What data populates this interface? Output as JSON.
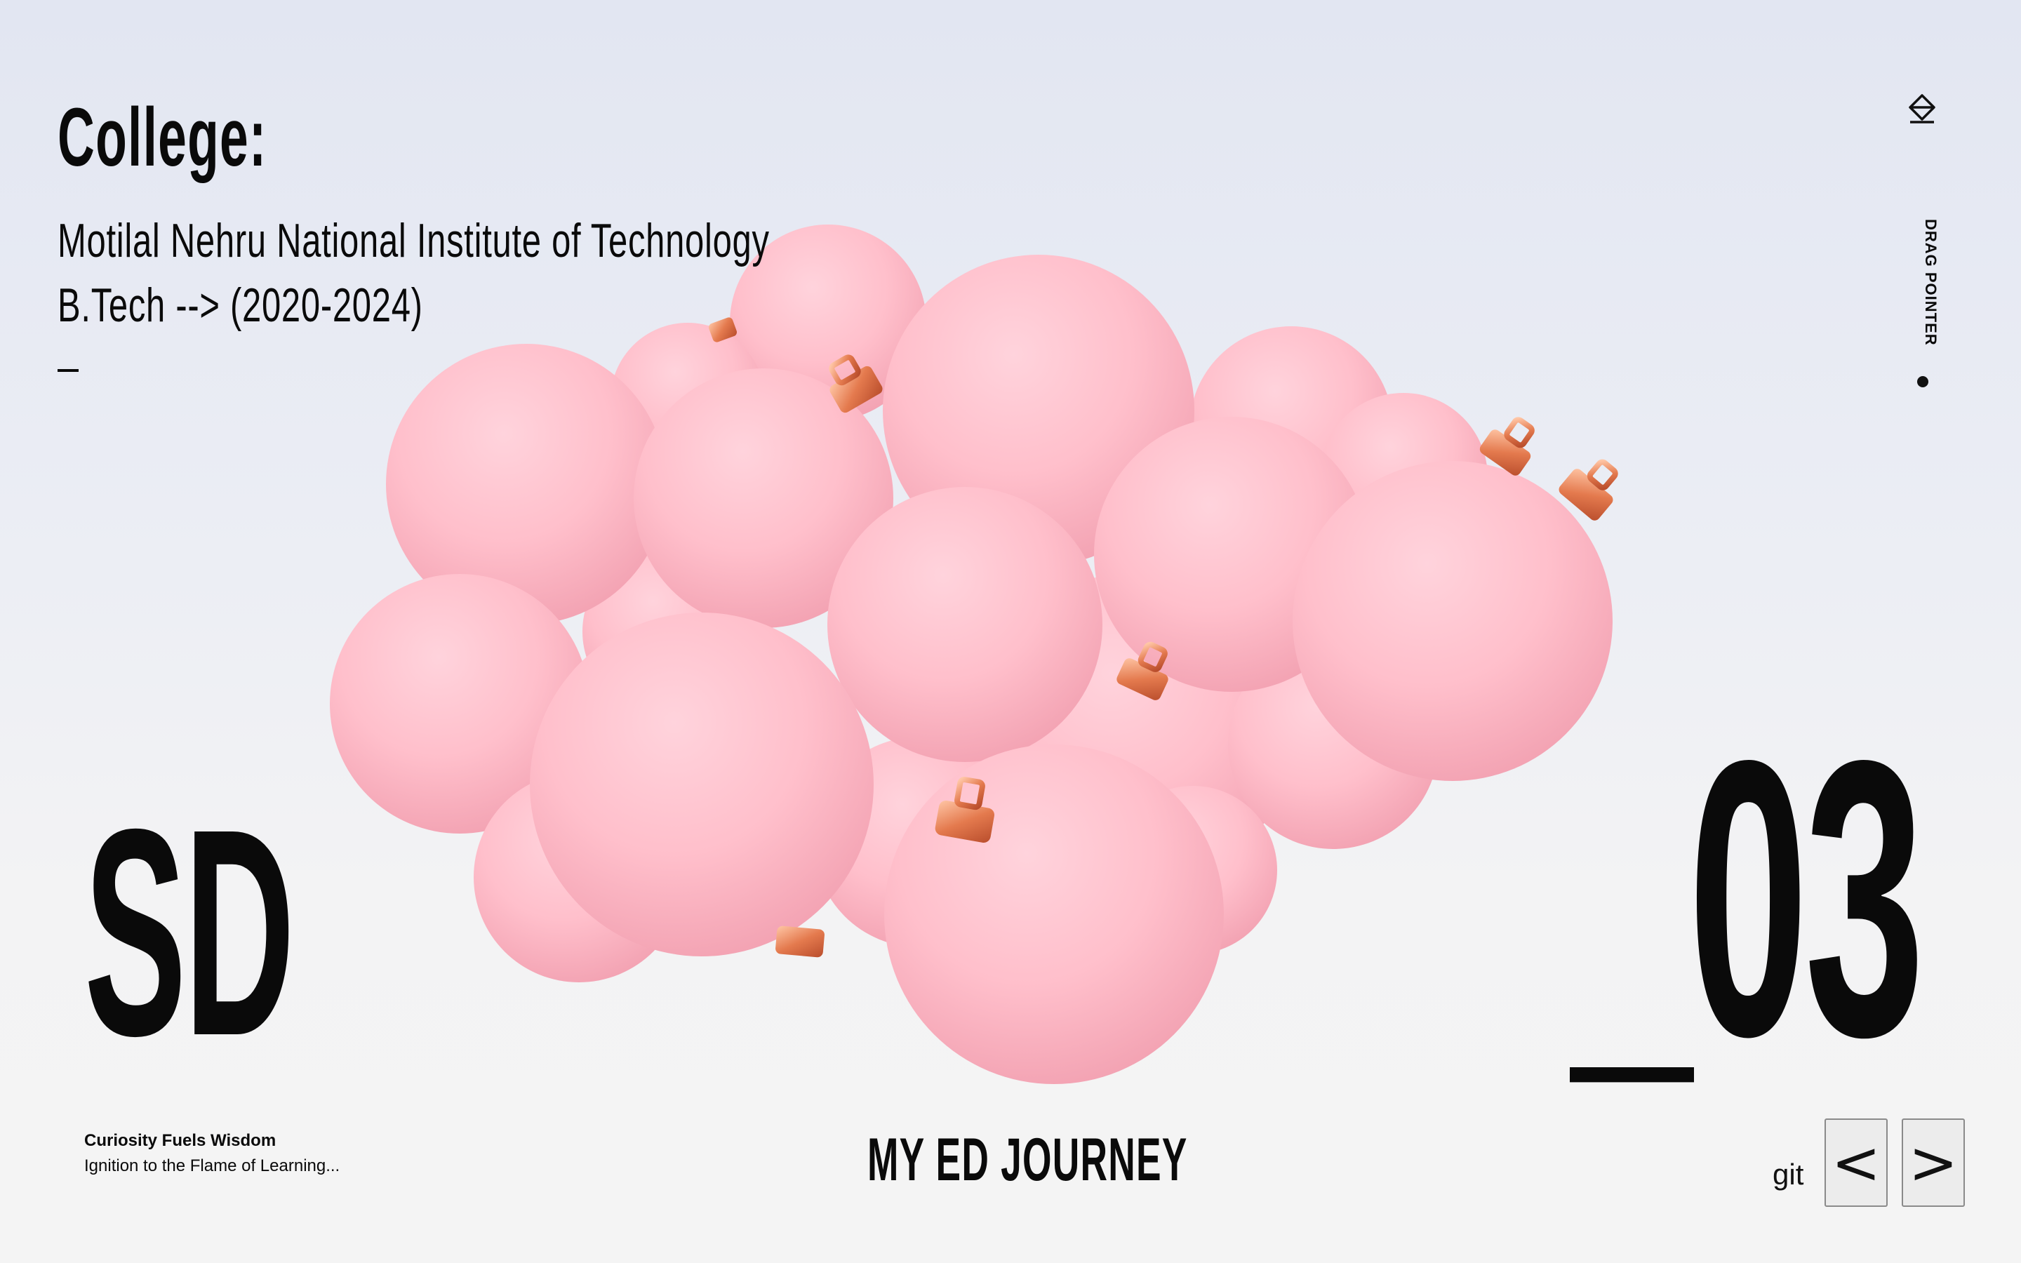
{
  "section": {
    "heading": "College:",
    "college_name": "Motilal Nehru National Institute of Technology",
    "degree": "B.Tech --> (2020-2024)"
  },
  "brand": {
    "logo_text": "SD"
  },
  "section_number": "_03",
  "tagline": {
    "title": "Curiosity Fuels Wisdom",
    "subtitle": "Ignition to the Flame of Learning..."
  },
  "footer": {
    "title": "MY ED JOURNEY",
    "git_label": "git",
    "prev_label": "<",
    "next_label": ">"
  },
  "sidebar": {
    "icon": "home-eraser-icon",
    "drag_label": "DRAG POINTER"
  },
  "colors": {
    "ornament_pink": "#ffc0cc",
    "ornament_cap": "#e8845a",
    "text": "#0a0a0a"
  }
}
